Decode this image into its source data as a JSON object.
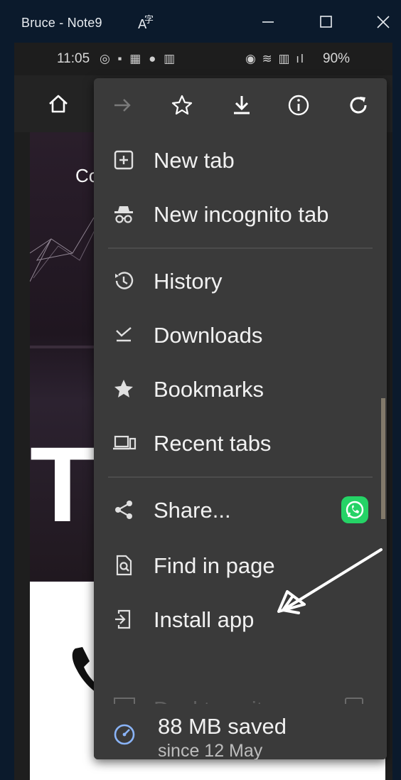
{
  "window": {
    "title": "Bruce - Note9"
  },
  "statusbar": {
    "time": "11:05",
    "battery": "90%"
  },
  "menu": {
    "items": [
      {
        "label": "New tab",
        "icon": "new-tab-icon"
      },
      {
        "label": "New incognito tab",
        "icon": "incognito-icon"
      },
      {
        "label": "History",
        "icon": "history-icon"
      },
      {
        "label": "Downloads",
        "icon": "downloads-icon"
      },
      {
        "label": "Bookmarks",
        "icon": "bookmarks-icon"
      },
      {
        "label": "Recent tabs",
        "icon": "recent-tabs-icon"
      },
      {
        "label": "Share...",
        "icon": "share-icon"
      },
      {
        "label": "Find in page",
        "icon": "find-in-page-icon"
      },
      {
        "label": "Install app",
        "icon": "install-app-icon"
      }
    ],
    "partially_hidden_item": "Desktop site",
    "savings": {
      "amount": "88 MB saved",
      "since": "since 12 May"
    }
  },
  "webpage": {
    "heading_partial": "Co",
    "big_letter": "T"
  },
  "colors": {
    "menu_bg": "#3a3a3a",
    "whatsapp": "#25d366",
    "savings_icon": "#8ab4f8"
  }
}
